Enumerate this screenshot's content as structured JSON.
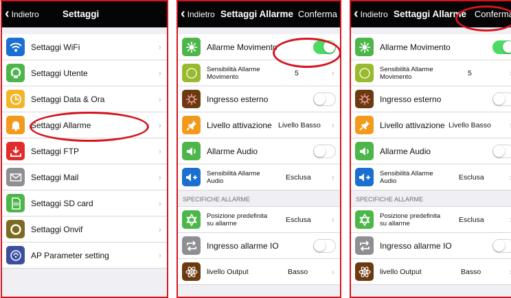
{
  "colors": {
    "accent_red": "#d6141e",
    "navbar": "#050505",
    "toggle_on": "#4cd964",
    "blue": "#1a6fd0",
    "green": "#4db64a",
    "orange": "#f29a1c",
    "olive": "#9aba2e",
    "brown": "#6b3a10",
    "red": "#e22c2c",
    "gray": "#8e8e93"
  },
  "screen1": {
    "back_label": "Indietro",
    "title": "Settaggi",
    "items": [
      {
        "label": "Settaggi WiFi",
        "icon": "wifi-icon"
      },
      {
        "label": "Settaggi Utente",
        "icon": "user-icon"
      },
      {
        "label": "Settaggi Data & Ora",
        "icon": "clock-icon"
      },
      {
        "label": "Settaggi Allarme",
        "icon": "bell-icon"
      },
      {
        "label": "Settaggi FTP",
        "icon": "download-icon"
      },
      {
        "label": "Settaggi Mail",
        "icon": "mail-icon"
      },
      {
        "label": "Settaggi SD card",
        "icon": "sd-card-icon"
      },
      {
        "label": "Settaggi Onvif",
        "icon": "onvif-icon"
      },
      {
        "label": "AP Parameter setting",
        "icon": "ap-icon"
      }
    ]
  },
  "screen2": {
    "back_label": "Indietro",
    "title": "Settaggi Allarme",
    "confirm_label": "Conferma",
    "section_label": "SPECIFICHE ALLARME",
    "items": [
      {
        "label": "Allarme Movimento",
        "toggle": true
      },
      {
        "label": "Sensibilità Allarme Movimento",
        "value": "5"
      },
      {
        "label": "Ingresso esterno",
        "toggle": false
      },
      {
        "label": "Livello attivazione",
        "value": "Livello Basso"
      },
      {
        "label": "Allarme Audio",
        "toggle": false
      },
      {
        "label": "Sensibilità Allarme Audio",
        "value": "Esclusa"
      },
      {
        "label": "Posizione predefinita su allarme",
        "value": "Esclusa"
      },
      {
        "label": "Ingresso allarme IO",
        "toggle": false
      },
      {
        "label": "livello Output",
        "value": "Basso"
      }
    ]
  },
  "screen3": {
    "back_label": "Indietro",
    "title": "Settaggi Allarme",
    "confirm_label": "Conferma",
    "section_label": "SPECIFICHE ALLARME",
    "items": [
      {
        "label": "Allarme Movimento",
        "toggle": true
      },
      {
        "label": "Sensibilità Allarme Movimento",
        "value": "5"
      },
      {
        "label": "Ingresso esterno",
        "toggle": false
      },
      {
        "label": "Livello attivazione",
        "value": "Livello Basso"
      },
      {
        "label": "Allarme Audio",
        "toggle": false
      },
      {
        "label": "Sensibilità Allarme Audio",
        "value": "Esclusa"
      },
      {
        "label": "Posizione predefinita su allarme",
        "value": "Esclusa"
      },
      {
        "label": "Ingresso allarme IO",
        "toggle": false
      },
      {
        "label": "livello Output",
        "value": "Basso"
      }
    ]
  }
}
